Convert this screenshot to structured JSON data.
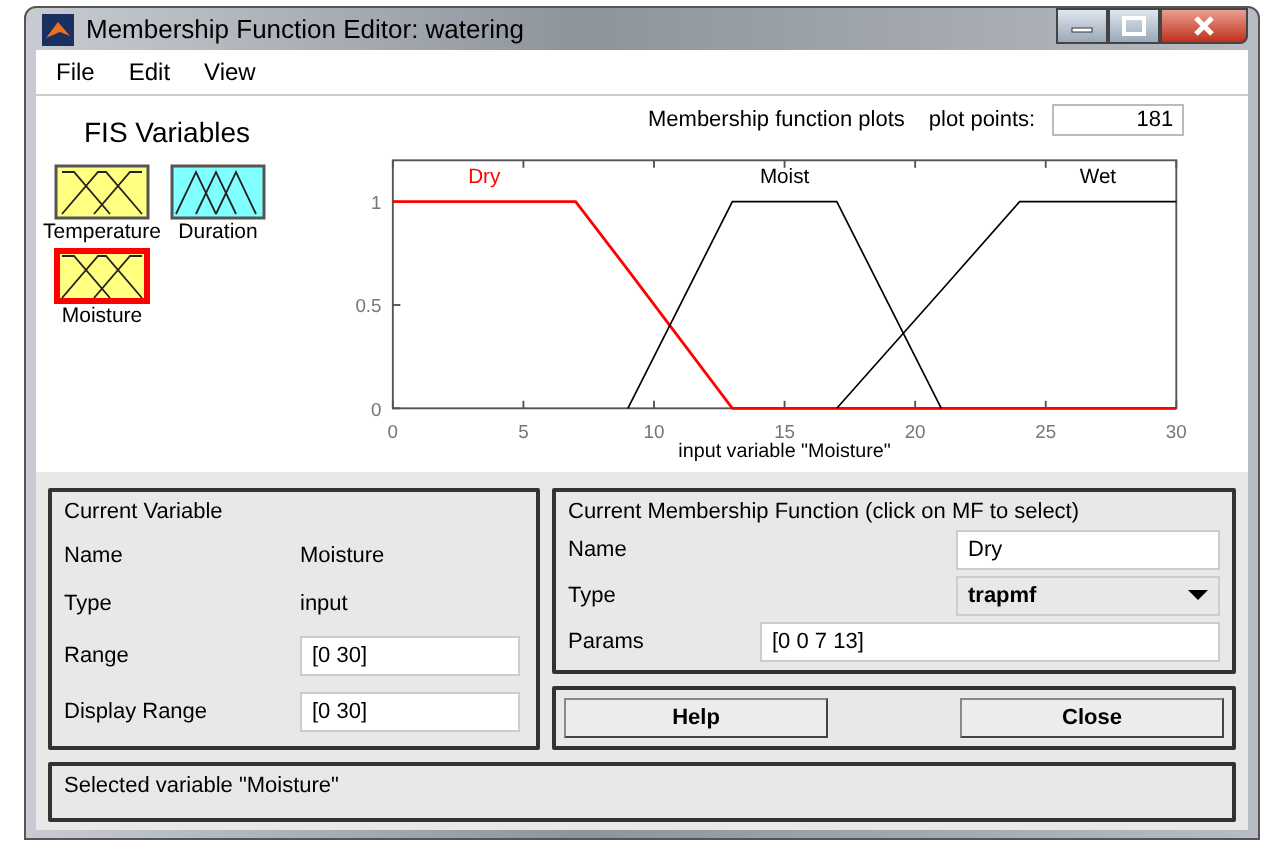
{
  "window": {
    "title": "Membership Function Editor: watering"
  },
  "menu": [
    "File",
    "Edit",
    "View"
  ],
  "fis_variables": {
    "title": "FIS Variables",
    "items": [
      {
        "name": "Temperature",
        "kind": "input",
        "selected": false
      },
      {
        "name": "Duration",
        "kind": "output",
        "selected": false
      },
      {
        "name": "Moisture",
        "kind": "input",
        "selected": true
      }
    ]
  },
  "plot_header": {
    "title": "Membership function plots",
    "plot_points_label": "plot points:",
    "plot_points": "181"
  },
  "chart_data": {
    "type": "line",
    "xlabel": "input variable \"Moisture\"",
    "x": [
      0,
      7,
      9,
      13,
      17,
      21,
      24,
      30
    ],
    "series": [
      {
        "name": "Dry",
        "color": "#ff0000",
        "values": [
          1,
          1,
          0.67,
          0,
          0,
          0,
          0,
          0
        ]
      },
      {
        "name": "Moist",
        "color": "#000000",
        "values": [
          null,
          null,
          0,
          1,
          1,
          0,
          null,
          null
        ]
      },
      {
        "name": "Wet",
        "color": "#000000",
        "values": [
          null,
          null,
          null,
          null,
          0,
          0.57,
          1,
          1
        ]
      }
    ],
    "xlim": [
      0,
      30
    ],
    "ylim": [
      0,
      1.2
    ],
    "xticks": [
      0,
      5,
      10,
      15,
      20,
      25,
      30
    ],
    "yticks": [
      0,
      0.5,
      1
    ]
  },
  "current_variable": {
    "title": "Current Variable",
    "name_label": "Name",
    "name": "Moisture",
    "type_label": "Type",
    "type": "input",
    "range_label": "Range",
    "range": "[0 30]",
    "display_range_label": "Display Range",
    "display_range": "[0 30]"
  },
  "current_mf": {
    "title": "Current Membership Function (click on MF to select)",
    "name_label": "Name",
    "name": "Dry",
    "type_label": "Type",
    "type": "trapmf",
    "params_label": "Params",
    "params": "[0 0 7 13]"
  },
  "buttons": [
    "Help",
    "Close"
  ],
  "status": "Selected variable \"Moisture\""
}
